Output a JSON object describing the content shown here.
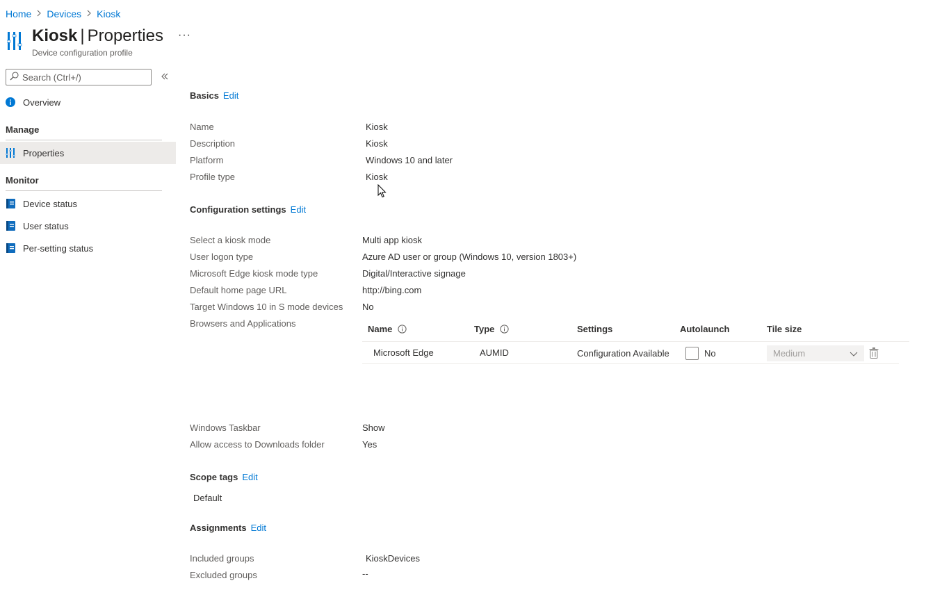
{
  "breadcrumb": [
    "Home",
    "Devices",
    "Kiosk"
  ],
  "header": {
    "title_main": "Kiosk",
    "title_sep": "|",
    "title_section": "Properties",
    "subtitle": "Device configuration profile",
    "more": "···"
  },
  "sidebar": {
    "search_placeholder": "Search (Ctrl+/)",
    "overview": "Overview",
    "groups": [
      {
        "title": "Manage",
        "items": [
          "Properties"
        ]
      },
      {
        "title": "Monitor",
        "items": [
          "Device status",
          "User status",
          "Per-setting status"
        ]
      }
    ],
    "selected": "Properties"
  },
  "edit_label": "Edit",
  "basics": {
    "title": "Basics",
    "rows": [
      {
        "label": "Name",
        "value": "Kiosk"
      },
      {
        "label": "Description",
        "value": "Kiosk"
      },
      {
        "label": "Platform",
        "value": "Windows 10 and later"
      },
      {
        "label": "Profile type",
        "value": "Kiosk"
      }
    ]
  },
  "config": {
    "title": "Configuration settings",
    "rows": [
      {
        "label": "Select a kiosk mode",
        "value": "Multi app kiosk"
      },
      {
        "label": "User logon type",
        "value": "Azure AD user or group (Windows 10, version 1803+)"
      },
      {
        "label": "Microsoft Edge kiosk mode type",
        "value": "Digital/Interactive signage"
      },
      {
        "label": "Default home page URL",
        "value": "http://bing.com"
      },
      {
        "label": "Target Windows 10 in S mode devices",
        "value": "No"
      }
    ],
    "apps_label": "Browsers and Applications",
    "apps_table": {
      "headers": [
        "Name",
        "Type",
        "Settings",
        "Autolaunch",
        "Tile size"
      ],
      "rows": [
        {
          "name": "Microsoft Edge",
          "type": "AUMID",
          "settings": "Configuration Available",
          "autolaunch": "No",
          "autolaunch_checked": false,
          "tile_size": "Medium"
        }
      ]
    },
    "rows_after": [
      {
        "label": "Windows Taskbar",
        "value": "Show"
      },
      {
        "label": "Allow access to Downloads folder",
        "value": "Yes"
      }
    ]
  },
  "scope": {
    "title": "Scope tags",
    "value": "Default"
  },
  "assignments": {
    "title": "Assignments",
    "rows": [
      {
        "label": "Included groups",
        "value": "KioskDevices"
      },
      {
        "label": "Excluded groups",
        "value": "--"
      }
    ]
  },
  "colors": {
    "link": "#0078d4",
    "text": "#323130",
    "muted": "#605e5c",
    "selected_bg": "#edebe9",
    "icon_blue": "#0078d4",
    "icon_teal": "#0f6cbd"
  }
}
